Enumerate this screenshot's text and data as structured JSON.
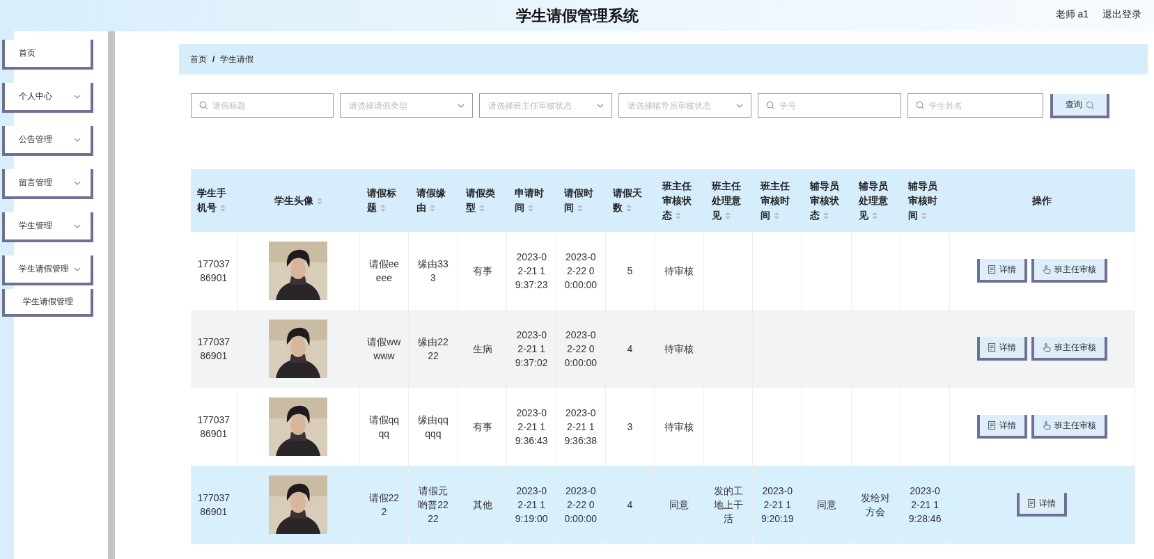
{
  "header": {
    "title": "学生请假管理系统",
    "user": "老师 a1",
    "logout": "退出登录"
  },
  "sidebar": {
    "items": [
      {
        "label": "首页",
        "expandable": false
      },
      {
        "label": "个人中心",
        "expandable": true
      },
      {
        "label": "公告管理",
        "expandable": true
      },
      {
        "label": "留言管理",
        "expandable": true
      },
      {
        "label": "学生管理",
        "expandable": true
      },
      {
        "label": "学生请假管理",
        "expandable": true,
        "children": [
          {
            "label": "学生请假管理"
          }
        ]
      }
    ]
  },
  "breadcrumb": [
    "首页",
    "学生请假"
  ],
  "breadcrumb_separator": "/",
  "filters": [
    {
      "kind": "search",
      "placeholder": "请假标题"
    },
    {
      "kind": "select",
      "placeholder": "请选择请假类型"
    },
    {
      "kind": "select",
      "placeholder": "请选择班主任审核状态"
    },
    {
      "kind": "select",
      "placeholder": "请选择辅导员审核状态"
    },
    {
      "kind": "search",
      "placeholder": "学号"
    },
    {
      "kind": "search",
      "placeholder": "学生姓名"
    }
  ],
  "search_button": "查询",
  "table": {
    "columns": [
      {
        "label": "学生手机号",
        "kind": "text",
        "sortable": true
      },
      {
        "label": "学生头像",
        "kind": "picture",
        "sortable": true
      },
      {
        "label": "请假标题",
        "kind": "text",
        "sortable": true
      },
      {
        "label": "请假缘由",
        "kind": "text",
        "sortable": true
      },
      {
        "label": "请假类型",
        "kind": "text",
        "sortable": true
      },
      {
        "label": "申请时间",
        "kind": "text",
        "sortable": true
      },
      {
        "label": "请假时间",
        "kind": "text",
        "sortable": true
      },
      {
        "label": "请假天数",
        "kind": "text",
        "sortable": true
      },
      {
        "label": "班主任审核状态",
        "kind": "text",
        "sortable": true
      },
      {
        "label": "班主任处理意见",
        "kind": "text",
        "sortable": true
      },
      {
        "label": "班主任审核时间",
        "kind": "text",
        "sortable": true
      },
      {
        "label": "辅导员审核状态",
        "kind": "text",
        "sortable": true
      },
      {
        "label": "辅导员处理意见",
        "kind": "text",
        "sortable": true
      },
      {
        "label": "辅导员审核时间",
        "kind": "text",
        "sortable": true
      },
      {
        "label": "操作",
        "kind": "actions",
        "sortable": false
      }
    ],
    "rows": [
      {
        "selected": false,
        "hovered": false,
        "cells": [
          "17703786901",
          "",
          "请假eeeee",
          "缘由333",
          "有事",
          "2023-02-21 19:37:23",
          "2023-02-22 00:00:00",
          "5",
          "待审核",
          "",
          "",
          "",
          "",
          ""
        ],
        "actions": [
          {
            "kind": "detail",
            "label": "详情"
          },
          {
            "kind": "review",
            "label": "班主任审核"
          }
        ]
      },
      {
        "selected": false,
        "hovered": true,
        "cells": [
          "17703786901",
          "",
          "请假wwwww",
          "缘由2222",
          "生病",
          "2023-02-21 19:37:02",
          "2023-02-22 00:00:00",
          "4",
          "待审核",
          "",
          "",
          "",
          "",
          ""
        ],
        "actions": [
          {
            "kind": "detail",
            "label": "详情"
          },
          {
            "kind": "review",
            "label": "班主任审核"
          }
        ]
      },
      {
        "selected": false,
        "hovered": false,
        "cells": [
          "17703786901",
          "",
          "请假qqqq",
          "缘由qqqqq",
          "有事",
          "2023-02-21 19:36:43",
          "2023-02-21 19:36:38",
          "3",
          "待审核",
          "",
          "",
          "",
          "",
          ""
        ],
        "actions": [
          {
            "kind": "detail",
            "label": "详情"
          },
          {
            "kind": "review",
            "label": "班主任审核"
          }
        ]
      },
      {
        "selected": true,
        "hovered": false,
        "cells": [
          "17703786901",
          "",
          "请假222",
          "请假元哟普2222",
          "其他",
          "2023-02-21 19:19:00",
          "2023-02-22 00:00:00",
          "4",
          "同意",
          "发的工地上干活",
          "2023-02-21 19:20:19",
          "同意",
          "发给对方会",
          "2023-02-21 19:28:46"
        ],
        "actions": [
          {
            "kind": "detail",
            "label": "详情"
          }
        ]
      }
    ]
  }
}
